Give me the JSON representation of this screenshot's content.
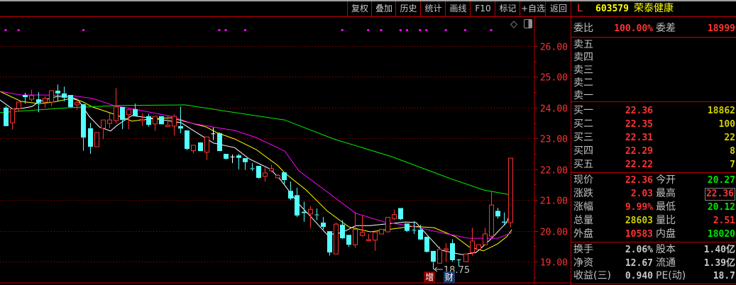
{
  "toolbar": {
    "buttons": [
      "复权",
      "叠加",
      "历史",
      "统计",
      "画线",
      "F10",
      "标记",
      "+自选",
      "返回"
    ]
  },
  "quote": {
    "market_flag": "L",
    "code": "603579",
    "name": "荣泰健康",
    "weibi_label": "委比",
    "weibi_value": "100.00%",
    "weicha_label": "委差",
    "weicha_value": "18999",
    "sell": [
      {
        "label": "卖五",
        "price": "",
        "vol": ""
      },
      {
        "label": "卖四",
        "price": "",
        "vol": ""
      },
      {
        "label": "卖三",
        "price": "",
        "vol": ""
      },
      {
        "label": "卖二",
        "price": "",
        "vol": ""
      },
      {
        "label": "卖一",
        "price": "",
        "vol": ""
      }
    ],
    "buy": [
      {
        "label": "买一",
        "price": "22.36",
        "vol": "18862"
      },
      {
        "label": "买二",
        "price": "22.35",
        "vol": "100"
      },
      {
        "label": "买三",
        "price": "22.31",
        "vol": "22"
      },
      {
        "label": "买四",
        "price": "22.29",
        "vol": "8"
      },
      {
        "label": "买五",
        "price": "22.22",
        "vol": "7"
      }
    ],
    "stats": [
      {
        "l1": "现价",
        "v1": "22.36",
        "c1": "red",
        "l2": "今开",
        "v2": "20.27",
        "c2": "grn"
      },
      {
        "l1": "涨跌",
        "v1": "2.03",
        "c1": "red",
        "l2": "最高",
        "v2": "22.36",
        "c2": "red"
      },
      {
        "l1": "涨幅",
        "v1": "9.99%",
        "c1": "red",
        "l2": "最低",
        "v2": "20.12",
        "c2": "grn"
      },
      {
        "l1": "总量",
        "v1": "28603",
        "c1": "yel",
        "l2": "量比",
        "v2": "2.51",
        "c2": "red"
      },
      {
        "l1": "外盘",
        "v1": "10583",
        "c1": "red",
        "l2": "内盘",
        "v2": "18020",
        "c2": "grn"
      }
    ],
    "info": [
      {
        "l1": "换手",
        "v1": "2.06%",
        "l2": "股本",
        "v2": "1.40亿"
      },
      {
        "l1": "净资",
        "v1": "12.67",
        "l2": "流通",
        "v2": "1.39亿"
      },
      {
        "l1": "收益(三)",
        "v1": "0.940",
        "l2": "PE(动)",
        "v2": "18.7"
      }
    ]
  },
  "colors": {
    "up": "#ff3232",
    "down": "#54ffff",
    "flat": "#ffffff",
    "grid": "#c00000",
    "ma5": "#ffffff",
    "ma10": "#ffff00",
    "ma20": "#ff00ff",
    "ma60": "#00ee00",
    "event_dot": "#ff00ff"
  },
  "chart_data": {
    "type": "candlestick",
    "ylim": [
      18.29,
      26.94
    ],
    "y_ticks": [
      "26.00",
      "25.00",
      "24.00",
      "23.00",
      "22.00",
      "21.00",
      "20.00",
      "19.00"
    ],
    "ohlc": [
      [
        24.0,
        24.05,
        23.4,
        23.4
      ],
      [
        23.51,
        23.98,
        23.3,
        23.95
      ],
      [
        23.97,
        24.18,
        23.9,
        24.18
      ],
      [
        24.41,
        24.48,
        24.13,
        24.34
      ],
      [
        24.27,
        24.58,
        24.2,
        24.39
      ],
      [
        24.27,
        24.5,
        23.85,
        24.16
      ],
      [
        24.18,
        24.37,
        24.0,
        24.3
      ],
      [
        24.18,
        24.55,
        24.05,
        24.55
      ],
      [
        24.55,
        24.75,
        24.2,
        24.46
      ],
      [
        24.46,
        24.68,
        24.2,
        24.32
      ],
      [
        24.41,
        24.41,
        24.0,
        24.02
      ],
      [
        24.09,
        24.3,
        23.93,
        24.16
      ],
      [
        24.11,
        24.11,
        22.6,
        23.03
      ],
      [
        23.33,
        23.5,
        22.5,
        22.73
      ],
      [
        22.73,
        23.19,
        22.73,
        23.19
      ],
      [
        23.33,
        23.6,
        22.98,
        23.6
      ],
      [
        23.49,
        23.82,
        23.33,
        23.6
      ],
      [
        23.58,
        24.63,
        23.49,
        24.02
      ],
      [
        24.02,
        24.02,
        23.3,
        23.6
      ],
      [
        23.77,
        23.96,
        23.3,
        23.93
      ],
      [
        23.95,
        24.13,
        23.72,
        23.72
      ],
      [
        23.58,
        23.82,
        23.4,
        23.62
      ],
      [
        23.72,
        23.8,
        23.38,
        23.44
      ],
      [
        23.47,
        23.72,
        23.25,
        23.72
      ],
      [
        23.72,
        23.72,
        23.46,
        23.46
      ],
      [
        23.38,
        23.74,
        23.36,
        23.43
      ],
      [
        23.4,
        23.78,
        23.1,
        23.72
      ],
      [
        23.4,
        24.03,
        23.17,
        23.32
      ],
      [
        23.26,
        23.26,
        22.62,
        22.66
      ],
      [
        22.6,
        22.8,
        22.52,
        22.78
      ],
      [
        22.87,
        22.87,
        22.59,
        22.59
      ],
      [
        22.55,
        23.05,
        22.3,
        23.05
      ],
      [
        23.15,
        23.35,
        22.95,
        23.15
      ],
      [
        23.17,
        23.2,
        22.59,
        22.59
      ],
      [
        22.5,
        22.5,
        22.32,
        22.34
      ],
      [
        22.4,
        22.48,
        22.2,
        22.4
      ],
      [
        22.45,
        22.5,
        22.0,
        22.37
      ],
      [
        22.36,
        22.36,
        21.98,
        22.23
      ],
      [
        22.02,
        22.2,
        21.95,
        22.0
      ],
      [
        22.11,
        22.11,
        21.7,
        21.72
      ],
      [
        21.77,
        22.05,
        21.6,
        21.88
      ],
      [
        21.95,
        22.15,
        21.9,
        22.02
      ],
      [
        21.72,
        21.85,
        21.7,
        21.8
      ],
      [
        21.9,
        21.9,
        21.5,
        21.65
      ],
      [
        21.3,
        21.6,
        21.0,
        21.05
      ],
      [
        21.16,
        21.4,
        20.45,
        20.5
      ],
      [
        20.62,
        20.95,
        20.3,
        20.58
      ],
      [
        20.55,
        20.8,
        20.1,
        20.7
      ],
      [
        20.52,
        20.73,
        20.35,
        20.5
      ],
      [
        20.27,
        20.45,
        20.05,
        20.13
      ],
      [
        19.99,
        19.99,
        19.2,
        19.3
      ],
      [
        19.25,
        20.27,
        19.25,
        20.22
      ],
      [
        20.2,
        20.35,
        19.74,
        19.76
      ],
      [
        19.87,
        19.87,
        19.48,
        19.55
      ],
      [
        19.55,
        20.6,
        19.45,
        20.05
      ],
      [
        19.85,
        20.5,
        19.82,
        19.95
      ],
      [
        19.68,
        19.9,
        19.66,
        19.72
      ],
      [
        19.7,
        19.96,
        19.35,
        19.96
      ],
      [
        19.9,
        20.05,
        19.9,
        20.05
      ],
      [
        19.97,
        20.44,
        19.95,
        20.44
      ],
      [
        20.4,
        20.69,
        20.35,
        20.53
      ],
      [
        20.74,
        20.74,
        20.35,
        20.38
      ],
      [
        20.24,
        20.24,
        19.97,
        20.0
      ],
      [
        20.02,
        20.32,
        19.9,
        20.0
      ],
      [
        20.04,
        20.2,
        19.7,
        19.72
      ],
      [
        19.81,
        19.81,
        19.3,
        19.32
      ],
      [
        19.35,
        19.35,
        18.75,
        19.0
      ],
      [
        18.95,
        19.5,
        18.95,
        19.4
      ],
      [
        19.38,
        19.6,
        19.0,
        19.42
      ],
      [
        19.6,
        19.73,
        19.0,
        19.05
      ],
      [
        19.06,
        19.08,
        18.85,
        19.05
      ],
      [
        19.0,
        19.25,
        19.0,
        19.25
      ],
      [
        19.3,
        20.1,
        19.2,
        19.67
      ],
      [
        19.4,
        19.55,
        19.4,
        19.55
      ],
      [
        19.55,
        20.1,
        19.55,
        19.9
      ],
      [
        19.83,
        21.3,
        19.75,
        20.84
      ],
      [
        20.65,
        20.75,
        20.4,
        20.47
      ],
      [
        20.3,
        20.6,
        20.2,
        20.27
      ],
      [
        20.27,
        22.36,
        20.12,
        22.36
      ]
    ],
    "ma": [
      {
        "name": "MA5",
        "color": "#ffffff",
        "points": [
          [
            -0.9,
            24.25
          ],
          [
            1.1,
            23.95
          ],
          [
            2.4,
            23.97
          ],
          [
            4.1,
            24.04
          ],
          [
            5.2,
            24.2
          ],
          [
            7.9,
            24.36
          ],
          [
            10.1,
            24.34
          ],
          [
            11.2,
            24.25
          ],
          [
            12.9,
            23.72
          ],
          [
            14.5,
            23.37
          ],
          [
            16.2,
            23.24
          ],
          [
            17.3,
            23.44
          ],
          [
            19.5,
            23.74
          ],
          [
            22.2,
            23.67
          ],
          [
            24.4,
            23.6
          ],
          [
            27.1,
            23.51
          ],
          [
            28.8,
            23.28
          ],
          [
            32.1,
            22.85
          ],
          [
            35.4,
            22.7
          ],
          [
            37.6,
            22.34
          ],
          [
            40.9,
            22.0
          ],
          [
            42.5,
            21.65
          ],
          [
            45.3,
            20.87
          ],
          [
            47.5,
            20.38
          ],
          [
            49.7,
            19.87
          ],
          [
            51.9,
            19.94
          ],
          [
            54.1,
            20.17
          ],
          [
            56.3,
            20.17
          ],
          [
            58.5,
            20.22
          ],
          [
            61.8,
            20.29
          ],
          [
            63.4,
            20.27
          ],
          [
            65.1,
            19.87
          ],
          [
            67.3,
            19.37
          ],
          [
            70.5,
            19.23
          ],
          [
            72.7,
            19.3
          ],
          [
            74.9,
            19.72
          ],
          [
            76.6,
            20.1
          ],
          [
            77.4,
            20.27
          ],
          [
            78.2,
            20.75
          ]
        ]
      },
      {
        "name": "MA10",
        "color": "#ffff00",
        "points": [
          [
            -0.9,
            24.53
          ],
          [
            2.4,
            24.2
          ],
          [
            5.2,
            24.13
          ],
          [
            7.4,
            24.18
          ],
          [
            10.1,
            24.3
          ],
          [
            11.8,
            24.2
          ],
          [
            13.4,
            24.02
          ],
          [
            16.7,
            23.79
          ],
          [
            19.5,
            23.56
          ],
          [
            22.2,
            23.63
          ],
          [
            25.5,
            23.67
          ],
          [
            28.8,
            23.49
          ],
          [
            31,
            23.37
          ],
          [
            32.6,
            23.19
          ],
          [
            35.4,
            22.98
          ],
          [
            38.7,
            22.64
          ],
          [
            42,
            22.13
          ],
          [
            43.1,
            21.88
          ],
          [
            46.4,
            21.33
          ],
          [
            49.7,
            20.64
          ],
          [
            53,
            20.13
          ],
          [
            56.3,
            19.97
          ],
          [
            59.6,
            20.06
          ],
          [
            62.9,
            20.15
          ],
          [
            66.2,
            20.1
          ],
          [
            69.5,
            19.81
          ],
          [
            71.6,
            19.48
          ],
          [
            73.8,
            19.35
          ],
          [
            76,
            19.58
          ],
          [
            77.4,
            19.81
          ],
          [
            78.2,
            20.04
          ]
        ]
      },
      {
        "name": "MA20",
        "color": "#ff00ff",
        "points": [
          [
            -0.9,
            24.53
          ],
          [
            2.4,
            24.41
          ],
          [
            5.7,
            24.41
          ],
          [
            10.1,
            24.39
          ],
          [
            13.4,
            24.3
          ],
          [
            16.7,
            24.07
          ],
          [
            21.1,
            23.9
          ],
          [
            25.5,
            23.72
          ],
          [
            28.8,
            23.49
          ],
          [
            32.1,
            23.37
          ],
          [
            35.4,
            23.26
          ],
          [
            38.7,
            23.03
          ],
          [
            43.1,
            22.59
          ],
          [
            45.3,
            21.95
          ],
          [
            49.7,
            21.26
          ],
          [
            54.1,
            20.57
          ],
          [
            58.5,
            20.29
          ],
          [
            62.9,
            20.15
          ],
          [
            67.3,
            19.94
          ],
          [
            71.6,
            19.76
          ],
          [
            76,
            19.76
          ],
          [
            78.2,
            19.94
          ]
        ]
      },
      {
        "name": "MA60",
        "color": "#00ee00",
        "points": [
          [
            -0.9,
            23.84
          ],
          [
            10.1,
            24.0
          ],
          [
            17.8,
            24.07
          ],
          [
            27.7,
            24.09
          ],
          [
            35.4,
            23.84
          ],
          [
            43.1,
            23.6
          ],
          [
            50.7,
            22.98
          ],
          [
            59.6,
            22.41
          ],
          [
            68.4,
            21.72
          ],
          [
            73.8,
            21.33
          ],
          [
            78.2,
            21.16
          ]
        ]
      }
    ],
    "event_dots": [
      0,
      2,
      12,
      33,
      34,
      37,
      52,
      56,
      58,
      61,
      62,
      64,
      65,
      68,
      71,
      75
    ],
    "low_annotation": {
      "index": 66,
      "price": 18.75,
      "text": "18.75"
    },
    "markers": [
      {
        "index": 65.5,
        "text": "增",
        "bg": "#800000"
      },
      {
        "index": 68.5,
        "text": "财",
        "bg": "#1a3a6a"
      }
    ]
  }
}
